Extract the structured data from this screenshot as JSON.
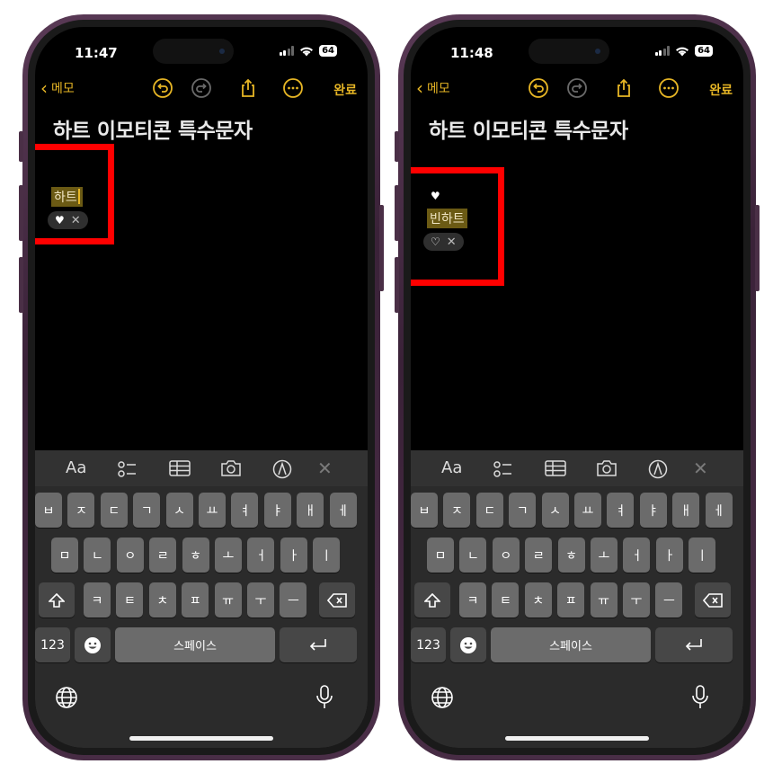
{
  "status": {
    "battery": "64"
  },
  "nav": {
    "back_label": "메모",
    "done_label": "완료"
  },
  "note": {
    "title": "하트 이모티콘 특수문자"
  },
  "phones": [
    {
      "time": "11:47",
      "typed_text": "하트",
      "suggestion": "♥"
    },
    {
      "time": "11:48",
      "typed_text": "빈하트",
      "inserted_glyph": "♥",
      "suggestion": "♡"
    }
  ],
  "suggestion_dismiss": "✕",
  "toolbar": {
    "format_label": "Aa",
    "close_glyph": "✕"
  },
  "keyboard": {
    "row1": [
      "ㅂ",
      "ㅈ",
      "ㄷ",
      "ㄱ",
      "ㅅ",
      "ㅛ",
      "ㅕ",
      "ㅑ",
      "ㅐ",
      "ㅔ"
    ],
    "row2": [
      "ㅁ",
      "ㄴ",
      "ㅇ",
      "ㄹ",
      "ㅎ",
      "ㅗ",
      "ㅓ",
      "ㅏ",
      "ㅣ"
    ],
    "row3": [
      "ㅋ",
      "ㅌ",
      "ㅊ",
      "ㅍ",
      "ㅠ",
      "ㅜ",
      "ㅡ"
    ],
    "numbers_label": "123",
    "space_label": "스페이스"
  },
  "colors": {
    "accent": "#e7b625",
    "highlight_box": "#ff0000",
    "phone_frame": "#4b2f48"
  },
  "icons": [
    "chevron-left-icon",
    "undo-icon",
    "redo-icon",
    "share-icon",
    "more-icon",
    "checklist-icon",
    "table-icon",
    "camera-icon",
    "markup-icon",
    "close-icon",
    "shift-icon",
    "backspace-icon",
    "emoji-icon",
    "return-icon",
    "globe-icon",
    "microphone-icon"
  ]
}
